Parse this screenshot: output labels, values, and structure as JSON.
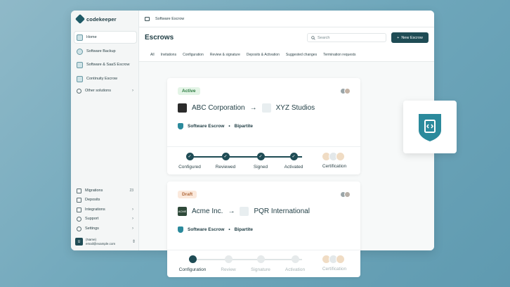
{
  "app": {
    "logo": "codekeeper"
  },
  "sidebar": {
    "items": [
      {
        "label": "Home",
        "active": true
      },
      {
        "label": "Software Backup"
      },
      {
        "label": "Software & SaaS Escrow"
      },
      {
        "label": "Continuity Escrow"
      },
      {
        "label": "Other solutions"
      }
    ],
    "bottom": [
      {
        "label": "Migrations",
        "count": "23"
      },
      {
        "label": "Deposits"
      },
      {
        "label": "Integrations"
      },
      {
        "label": "Support"
      },
      {
        "label": "Settings"
      }
    ],
    "user": {
      "initial": "U",
      "name": "(Name)",
      "email": "email@example.com"
    }
  },
  "topbar": {
    "breadcrumb": "Software Escrow"
  },
  "header": {
    "title": "Escrows",
    "search_placeholder": "Search",
    "new_button": "New Escrow",
    "plus": "+"
  },
  "tabs": [
    "All",
    "Invitations",
    "Configuration",
    "Review & signature",
    "Deposits & Activation",
    "Suggested changes",
    "Termination requests"
  ],
  "escrows": [
    {
      "status": "Active",
      "depositor": "ABC Corporation",
      "beneficiary": "XYZ Studios",
      "product": "Software Escrow",
      "type": "Bipartite",
      "steps": [
        "Configured",
        "Reviewed",
        "Signed",
        "Activated",
        "Certification"
      ]
    },
    {
      "status": "Draft",
      "depositor": "Acme Inc.",
      "depositor_logo": "ACME",
      "beneficiary": "PQR International",
      "product": "Software Escrow",
      "type": "Bipartite",
      "steps": [
        "Configuration",
        "Review",
        "Signature",
        "Activation",
        "Certification"
      ]
    }
  ],
  "colors": {
    "accent": "#1f4c55",
    "active_badge": "#e3f4e6",
    "draft_badge": "#fbe9dc",
    "brand_teal": "#2b8a9c"
  }
}
